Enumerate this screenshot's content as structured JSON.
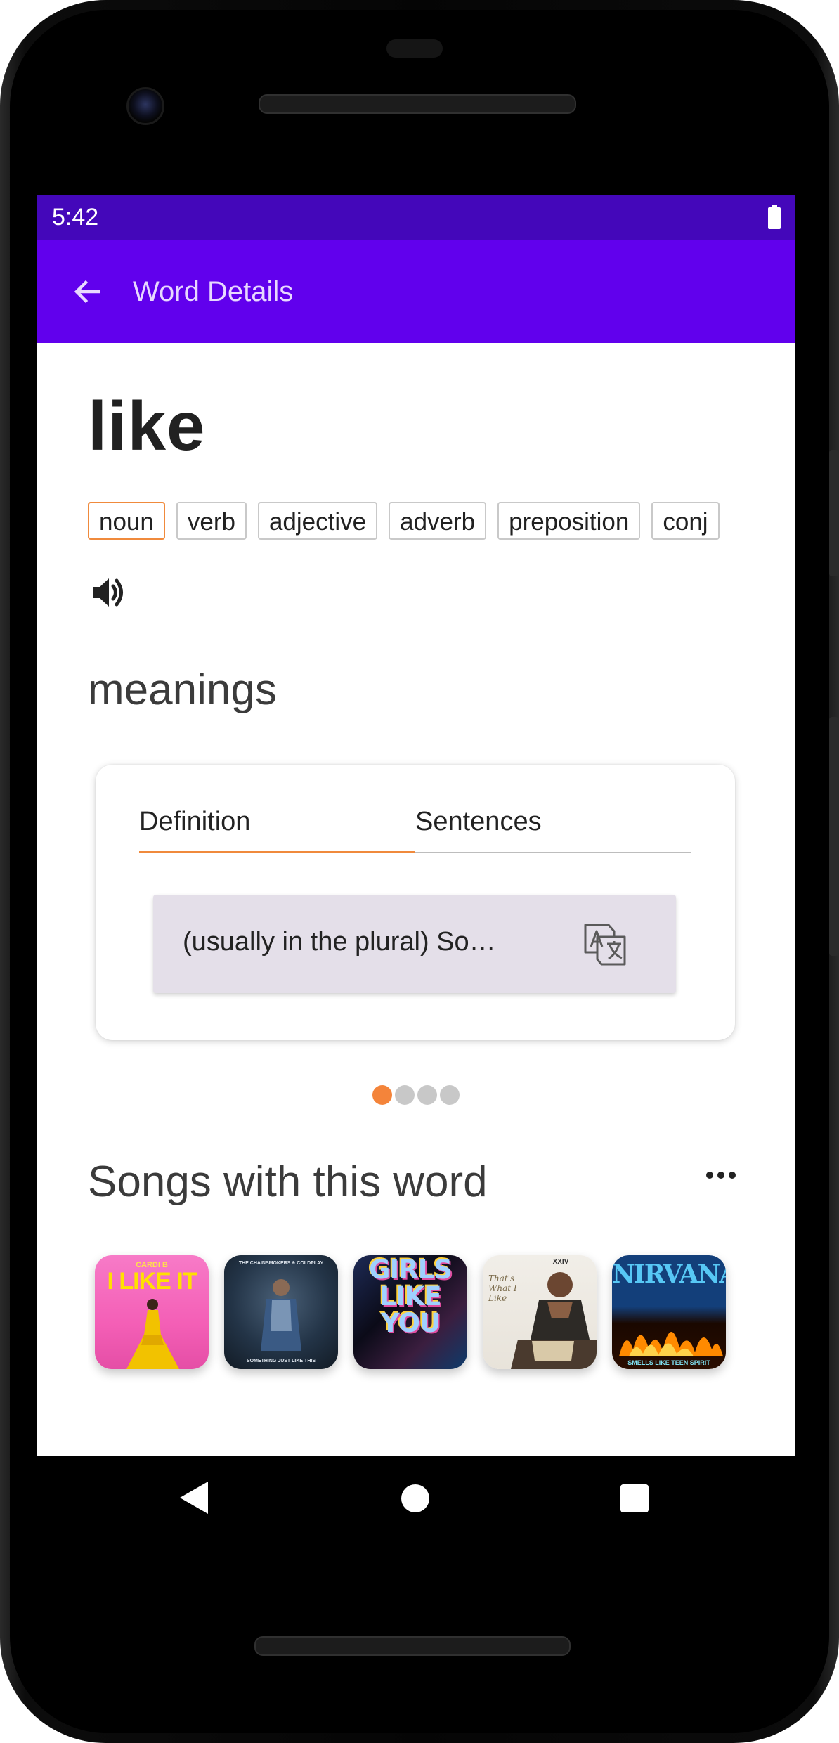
{
  "status_bar": {
    "time": "5:42"
  },
  "app_bar": {
    "title": "Word Details"
  },
  "word": "like",
  "parts_of_speech": [
    {
      "label": "noun",
      "selected": true
    },
    {
      "label": "verb",
      "selected": false
    },
    {
      "label": "adjective",
      "selected": false
    },
    {
      "label": "adverb",
      "selected": false
    },
    {
      "label": "preposition",
      "selected": false
    },
    {
      "label": "conj",
      "selected": false
    }
  ],
  "meanings": {
    "title": "meanings",
    "tabs": [
      {
        "label": "Definition",
        "active": true
      },
      {
        "label": "Sentences",
        "active": false
      }
    ],
    "definition_text": "(usually in the plural) So…",
    "pager": {
      "total": 4,
      "active_index": 0
    }
  },
  "songs": {
    "title": "Songs with this word",
    "covers": [
      {
        "name": "cover-1",
        "text": "I LIKE IT",
        "top_text": "CARDI B"
      },
      {
        "name": "cover-2",
        "text": "SOMETHING JUST LIKE THIS",
        "top_text": "THE CHAINSMOKERS & COLDPLAY"
      },
      {
        "name": "cover-3",
        "text": "GIRLS LIKE YOU",
        "top_text": ""
      },
      {
        "name": "cover-4",
        "text": "That's What I Like",
        "top_text": "XXIV"
      },
      {
        "name": "cover-5",
        "text": "NIRVANA",
        "top_text": "SMELLS LIKE TEEN SPIRIT"
      }
    ]
  },
  "colors": {
    "status_bar": "#4407ba",
    "app_bar": "#6100ed",
    "accent": "#f08a3c",
    "definition_bg": "#e4dfe9"
  },
  "icons": {
    "back": "arrow-left-icon",
    "volume": "volume-icon",
    "translate": "translate-icon",
    "more": "more-horizontal-icon",
    "battery": "battery-icon"
  }
}
